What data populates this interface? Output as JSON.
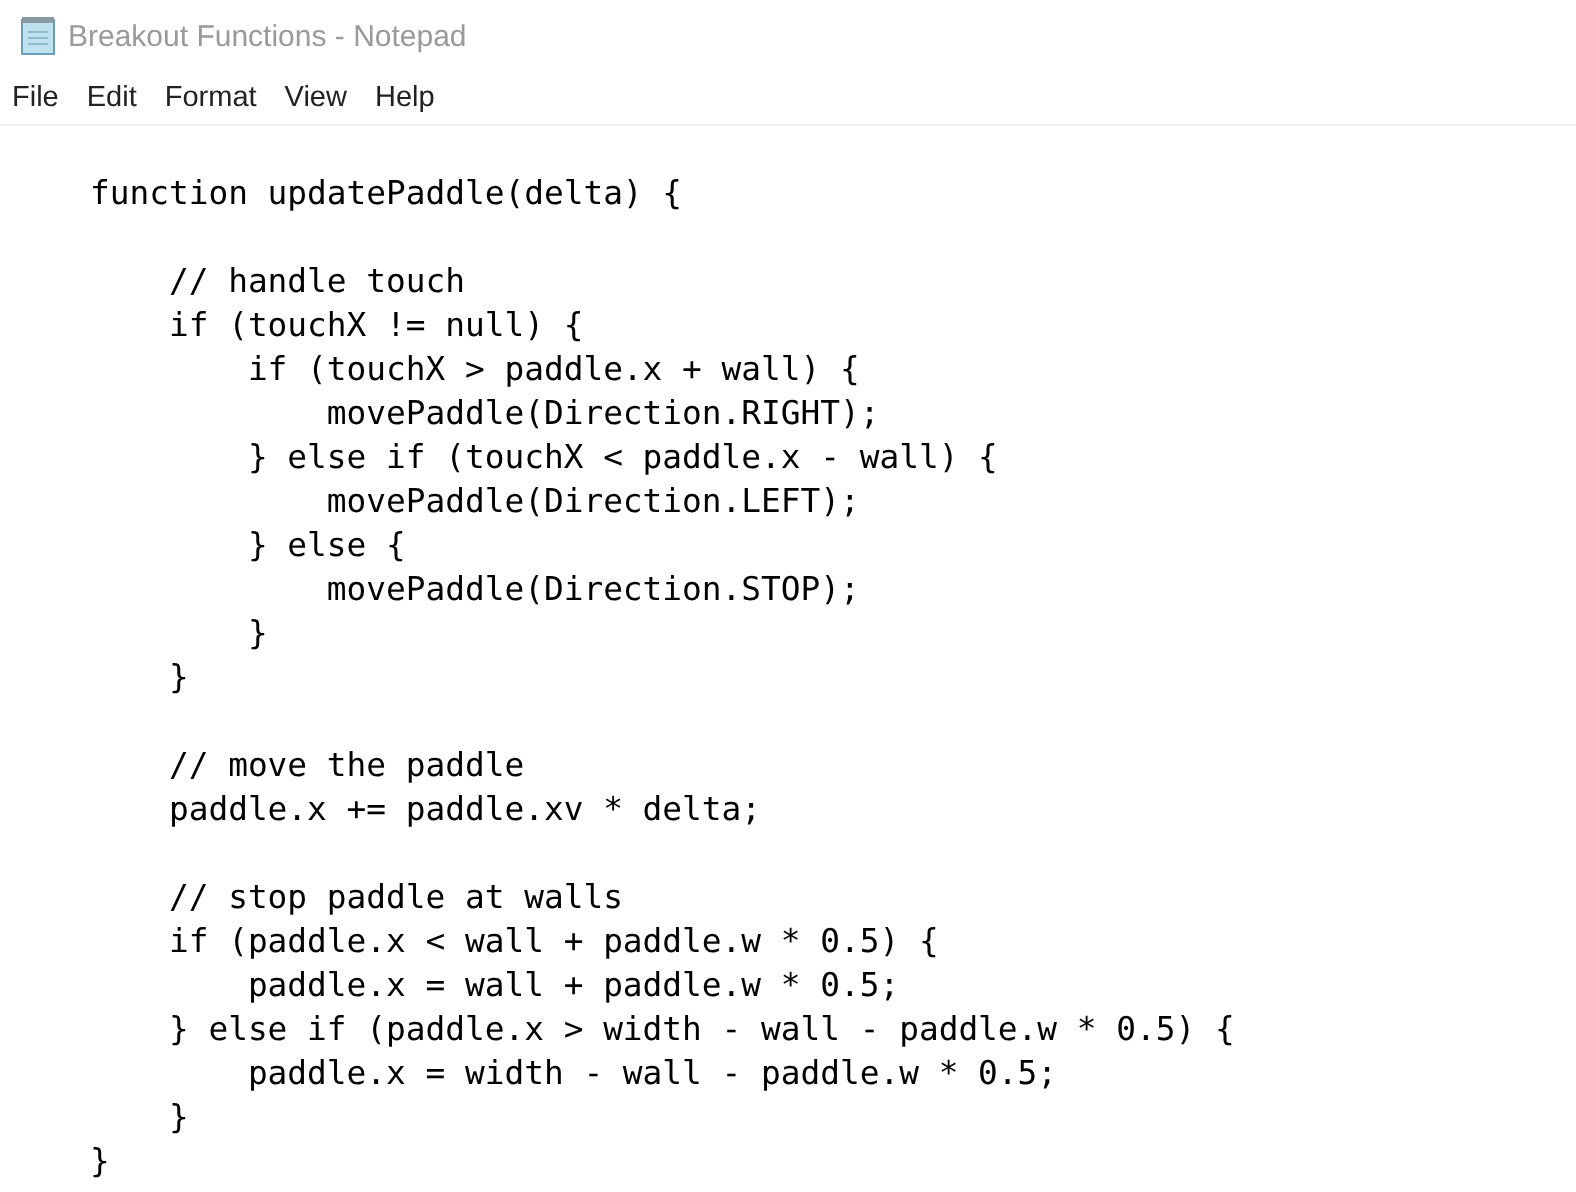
{
  "window": {
    "title": "Breakout Functions - Notepad"
  },
  "menu": [
    "File",
    "Edit",
    "Format",
    "View",
    "Help"
  ],
  "editor": {
    "lines": [
      {
        "kind": "code",
        "text": "function updatePaddle(delta) {"
      },
      {
        "kind": "blank"
      },
      {
        "kind": "code",
        "text": "    // handle touch"
      },
      {
        "kind": "code",
        "text": "    if (touchX != null) {"
      },
      {
        "kind": "code",
        "text": "        if (touchX > paddle.x + wall) {"
      },
      {
        "kind": "code",
        "text": "            movePaddle(Direction.RIGHT);"
      },
      {
        "kind": "code",
        "text": "        } else if (touchX < paddle.x - wall) {"
      },
      {
        "kind": "code",
        "text": "            movePaddle(Direction.LEFT);"
      },
      {
        "kind": "code",
        "text": "        } else {"
      },
      {
        "kind": "code",
        "text": "            movePaddle(Direction.STOP);"
      },
      {
        "kind": "code",
        "text": "        }"
      },
      {
        "kind": "code",
        "text": "    }"
      },
      {
        "kind": "blank"
      },
      {
        "kind": "code",
        "text": "    // move the paddle"
      },
      {
        "kind": "code",
        "text": "    paddle.x += paddle.xv * delta;"
      },
      {
        "kind": "blank"
      },
      {
        "kind": "code",
        "text": "    // stop paddle at walls"
      },
      {
        "kind": "code",
        "text": "    if (paddle.x < wall + paddle.w * 0.5) {"
      },
      {
        "kind": "code",
        "text": "        paddle.x = wall + paddle.w * 0.5;"
      },
      {
        "kind": "code",
        "text": "    } else if (paddle.x > width - wall - paddle.w * 0.5) {"
      },
      {
        "kind": "code",
        "text": "        paddle.x = width - wall - paddle.w * 0.5;"
      },
      {
        "kind": "code",
        "text": "    }"
      },
      {
        "kind": "code",
        "text": "}"
      }
    ]
  }
}
